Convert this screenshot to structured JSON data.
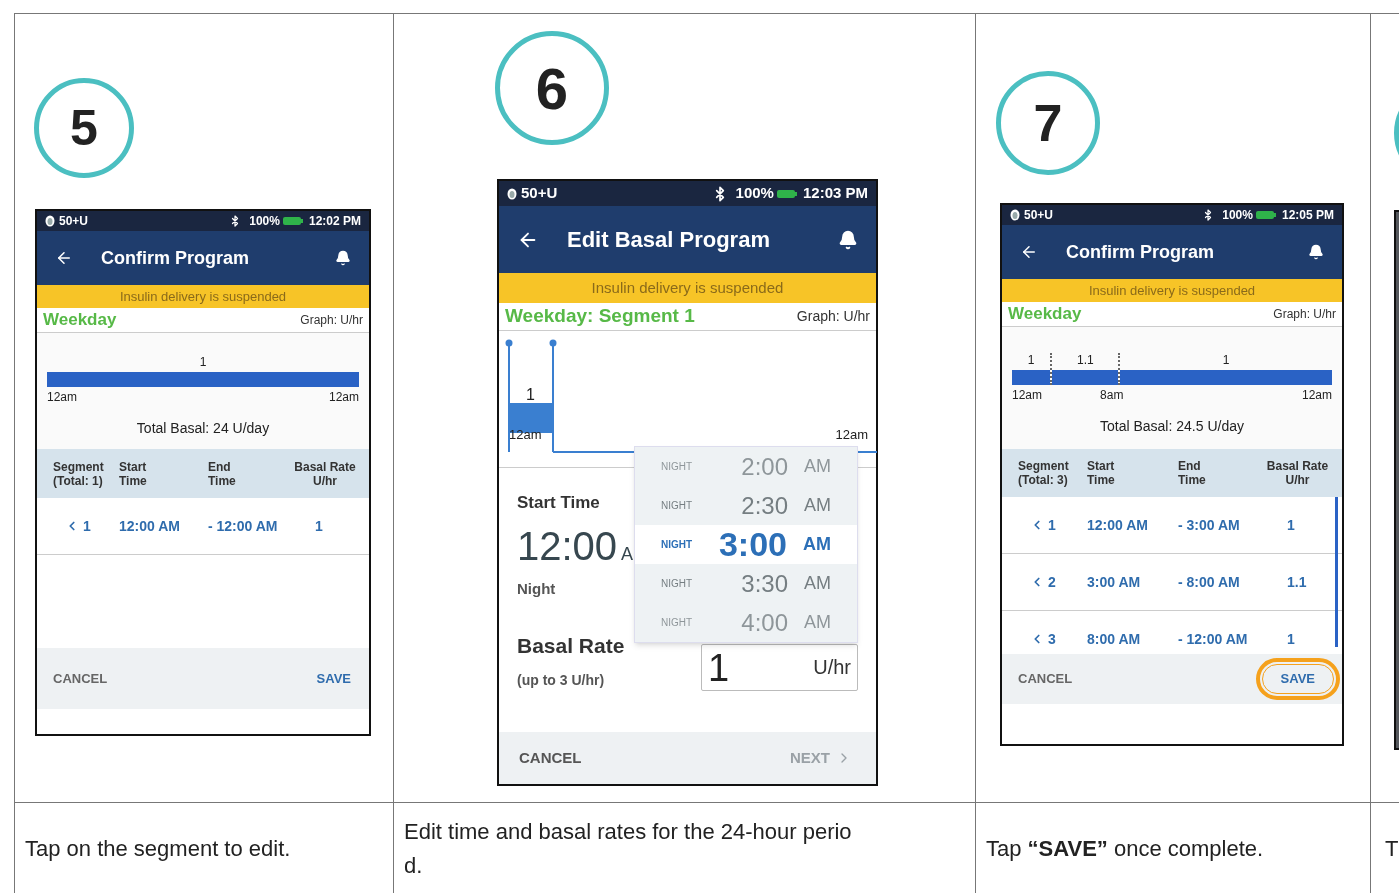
{
  "steps": [
    {
      "number": "5",
      "caption": [
        "Tap on the segment to edit."
      ],
      "screen": {
        "kind": "confirm",
        "status": {
          "reservoir": "50+U",
          "battery": "100%",
          "time": "12:02 PM"
        },
        "title": "Confirm Program",
        "banner": "Insulin delivery is suspended",
        "program": "Weekday",
        "graph_unit": "Graph: U/hr",
        "graph": {
          "segments": [
            "1"
          ],
          "ticks": [
            "12am",
            "12am"
          ]
        },
        "total": "Total Basal: 24 U/day",
        "columns": [
          [
            "Segment",
            "(Total: 1)"
          ],
          [
            "Start",
            "Time"
          ],
          [
            "End",
            "Time"
          ],
          [
            "Basal Rate",
            "U/hr"
          ]
        ],
        "rows": [
          {
            "segment": "1",
            "start": "12:00 AM",
            "end": "- 12:00 AM",
            "rate": "1"
          }
        ],
        "cancel": "CANCEL",
        "save": {
          "label": "SAVE",
          "highlighted": false
        }
      }
    },
    {
      "number": "6",
      "caption": [
        "Edit time and basal rates for the 24-hour perio",
        "d."
      ],
      "screen": {
        "kind": "edit",
        "status": {
          "reservoir": "50+U",
          "battery": "100%",
          "time": "12:03 PM"
        },
        "title": "Edit Basal Program",
        "banner": "Insulin delivery is suspended",
        "program": "Weekday: Segment 1",
        "graph_unit": "Graph: U/hr",
        "graph": {
          "label": "1",
          "ticks": [
            "12am",
            "12am"
          ]
        },
        "start_label": "Start Time",
        "start_time": "12:00",
        "start_suffix": "A",
        "period": "Night",
        "rate_label": "Basal Rate",
        "rate_hint": "(up to 3 U/hr)",
        "rate_value": "1",
        "rate_unit": "U/hr",
        "picker": [
          {
            "period": "NIGHT",
            "time": "2:00",
            "ampm": "AM",
            "selected": false
          },
          {
            "period": "NIGHT",
            "time": "2:30",
            "ampm": "AM",
            "selected": false
          },
          {
            "period": "NIGHT",
            "time": "3:00",
            "ampm": "AM",
            "selected": true
          },
          {
            "period": "NIGHT",
            "time": "3:30",
            "ampm": "AM",
            "selected": false
          },
          {
            "period": "NIGHT",
            "time": "4:00",
            "ampm": "AM",
            "selected": false
          }
        ],
        "cancel": "CANCEL",
        "next": {
          "label": "NEXT",
          "disabled": true
        }
      }
    },
    {
      "number": "7",
      "caption": [
        "Tap **“SAVE”** once complete."
      ],
      "screen": {
        "kind": "confirm",
        "status": {
          "reservoir": "50+U",
          "battery": "100%",
          "time": "12:05 PM"
        },
        "title": "Confirm Program",
        "banner": "Insulin delivery is suspended",
        "program": "Weekday",
        "graph_unit": "Graph: U/hr",
        "graph": {
          "segments": [
            "1",
            "1.1",
            "1"
          ],
          "ticks": [
            "12am",
            "8am",
            "12am"
          ]
        },
        "total": "Total Basal: 24.5 U/day",
        "columns": [
          [
            "Segment",
            "(Total: 3)"
          ],
          [
            "Start",
            "Time"
          ],
          [
            "End",
            "Time"
          ],
          [
            "Basal Rate",
            "U/hr"
          ]
        ],
        "rows": [
          {
            "segment": "1",
            "start": "12:00 AM",
            "end": "- 3:00 AM",
            "rate": "1"
          },
          {
            "segment": "2",
            "start": "3:00 AM",
            "end": "- 8:00 AM",
            "rate": "1.1"
          },
          {
            "segment": "3",
            "start": "8:00 AM",
            "end": "- 12:00 AM",
            "rate": "1"
          }
        ],
        "cancel": "CANCEL",
        "save": {
          "label": "SAVE",
          "highlighted": true
        }
      }
    }
  ],
  "partial_step": {
    "caption": "T"
  }
}
